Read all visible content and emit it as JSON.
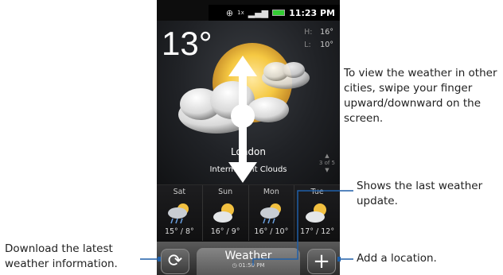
{
  "status_bar": {
    "time": "11:23 PM",
    "network_label": "1x"
  },
  "weather": {
    "temperature": "13°",
    "high_label": "H:",
    "high": "16°",
    "low_label": "L:",
    "low": "10°",
    "city": "London",
    "condition": "Intermittent Clouds",
    "pager": "3 of 5"
  },
  "forecast": [
    {
      "day": "Sat",
      "temps": "15° / 8°",
      "icon": "rain-cloud-icon"
    },
    {
      "day": "Sun",
      "temps": "16° / 9°",
      "icon": "sun-cloud-icon"
    },
    {
      "day": "Mon",
      "temps": "16° / 10°",
      "icon": "rain-cloud-icon"
    },
    {
      "day": "Tue",
      "temps": "17° / 12°",
      "icon": "sun-cloud-icon"
    }
  ],
  "bottom_bar": {
    "tab_label": "Weather",
    "last_update": "01:50 PM"
  },
  "callouts": {
    "swipe": "To view the weather in other cities, swipe your finger upward/downward on the screen.",
    "update": "Shows the last weather update.",
    "add": "Add a location.",
    "download": "Download the latest weather information."
  },
  "colors": {
    "callout_line": "#1f5fa8",
    "arrow": "#ffffff",
    "battery": "#33cc33"
  }
}
